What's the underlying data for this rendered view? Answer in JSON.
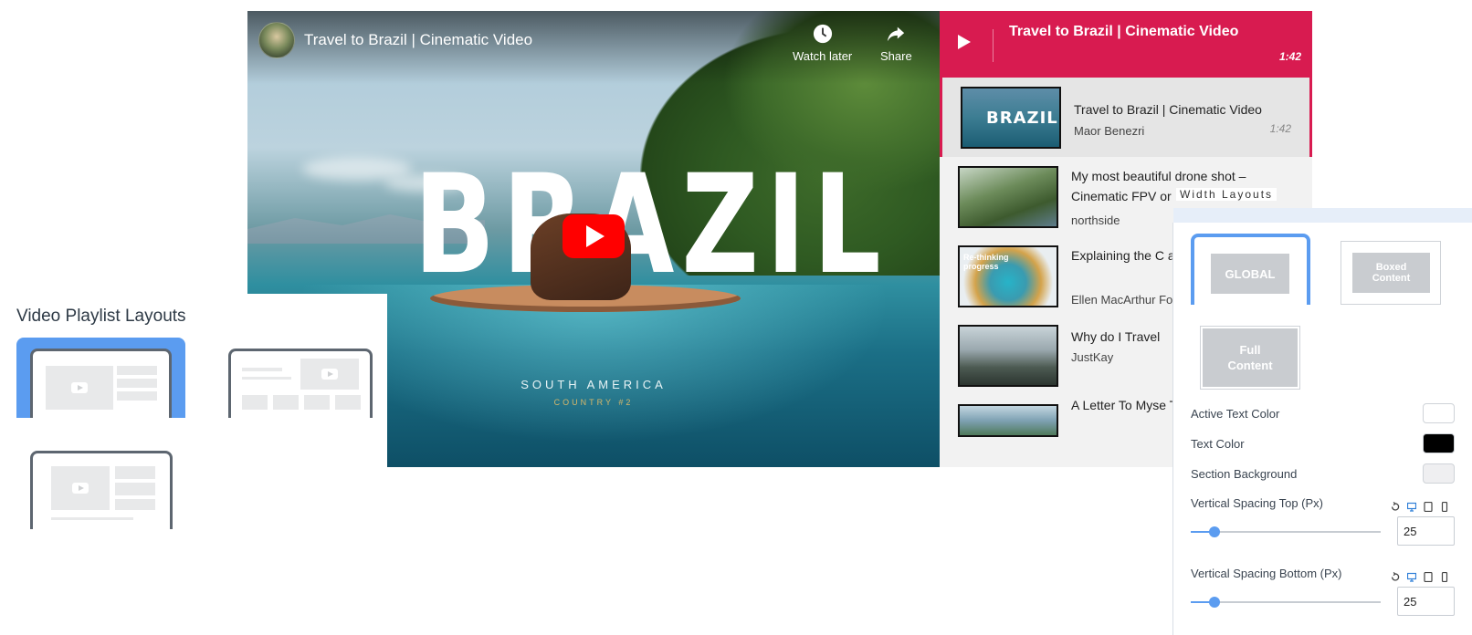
{
  "player": {
    "title": "Travel to Brazil | Cinematic Video",
    "watch_later_label": "Watch later",
    "share_label": "Share",
    "overlay_word": "BRAZIL",
    "overlay_sub1": "SOUTH AMERICA",
    "overlay_sub2": "COUNTRY #2"
  },
  "playlist": {
    "header_title": "Travel to Brazil | Cinematic Video",
    "header_duration": "1:42",
    "accent_color": "#d81b50",
    "items": [
      {
        "title": "Travel to Brazil | Cinematic Video",
        "author": "Maor Benezri",
        "duration": "1:42",
        "thumb_text": "BRAZIL"
      },
      {
        "title": "My most beautiful drone shot – Cinematic FPV or",
        "author": "northside",
        "duration": ""
      },
      {
        "title": "Explaining the C and How Society",
        "author": "Ellen MacArthur Fo",
        "duration": "",
        "thumb_text": "Re-thinking progress"
      },
      {
        "title": "Why do I Travel",
        "author": "JustKay",
        "duration": ""
      },
      {
        "title": "A Letter To Myse Travel Film",
        "author": "",
        "duration": ""
      }
    ]
  },
  "layouts": {
    "heading": "Video Playlist Layouts",
    "selected_color": "#5b9cf0"
  },
  "settings": {
    "width_layouts_title": "Width Layouts",
    "options": [
      "GLOBAL",
      "Boxed Content",
      "Full Content"
    ],
    "active_text_color_label": "Active Text Color",
    "active_text_color": "#ffffff",
    "text_color_label": "Text Color",
    "text_color": "#000000",
    "section_background_label": "Section Background",
    "section_background": "#efeff1",
    "spacing_top_label": "Vertical Spacing Top (Px)",
    "spacing_top_value": "25",
    "spacing_bottom_label": "Vertical Spacing Bottom (Px)",
    "spacing_bottom_value": "25"
  }
}
